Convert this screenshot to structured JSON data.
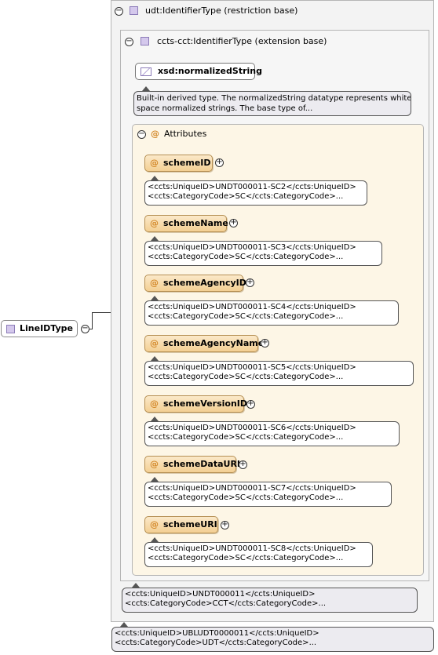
{
  "root": {
    "label": "LineIDType",
    "toggle": "−"
  },
  "udt": {
    "label": "udt:IdentifierType (restriction base)",
    "toggle": "−"
  },
  "ccts": {
    "label": "ccts-cct:IdentifierType (extension base)",
    "toggle": "−"
  },
  "xsd": {
    "label": "xsd:normalizedString",
    "doc_line1": "Built-in derived type. The normalizedString datatype represents white",
    "doc_line2": "space normalized strings. The base type of..."
  },
  "attributes": {
    "label": "Attributes",
    "toggle": "−",
    "items": [
      {
        "name": "schemeID",
        "expand": "+",
        "doc_line1": "<ccts:UniqueID>UNDT000011-SC2</ccts:UniqueID>",
        "doc_line2": "<ccts:CategoryCode>SC</ccts:CategoryCode>..."
      },
      {
        "name": "schemeName",
        "expand": "+",
        "doc_line1": "<ccts:UniqueID>UNDT000011-SC3</ccts:UniqueID>",
        "doc_line2": "<ccts:CategoryCode>SC</ccts:CategoryCode>..."
      },
      {
        "name": "schemeAgencyID",
        "expand": "+",
        "doc_line1": "<ccts:UniqueID>UNDT000011-SC4</ccts:UniqueID>",
        "doc_line2": "<ccts:CategoryCode>SC</ccts:CategoryCode>..."
      },
      {
        "name": "schemeAgencyName",
        "expand": "+",
        "doc_line1": "<ccts:UniqueID>UNDT000011-SC5</ccts:UniqueID>",
        "doc_line2": "<ccts:CategoryCode>SC</ccts:CategoryCode>..."
      },
      {
        "name": "schemeVersionID",
        "expand": "+",
        "doc_line1": "<ccts:UniqueID>UNDT000011-SC6</ccts:UniqueID>",
        "doc_line2": "<ccts:CategoryCode>SC</ccts:CategoryCode>..."
      },
      {
        "name": "schemeDataURI",
        "expand": "+",
        "doc_line1": "<ccts:UniqueID>UNDT000011-SC7</ccts:UniqueID>",
        "doc_line2": "<ccts:CategoryCode>SC</ccts:CategoryCode>..."
      },
      {
        "name": "schemeURI",
        "expand": "+",
        "doc_line1": "<ccts:UniqueID>UNDT000011-SC8</ccts:UniqueID>",
        "doc_line2": "<ccts:CategoryCode>SC</ccts:CategoryCode>..."
      }
    ]
  },
  "ccts_doc": {
    "line1": "<ccts:UniqueID>UNDT000011</ccts:UniqueID>",
    "line2": "<ccts:CategoryCode>CCT</ccts:CategoryCode>..."
  },
  "udt_doc": {
    "line1": "<ccts:UniqueID>UBLUDT0000011</ccts:UniqueID>",
    "line2": "<ccts:CategoryCode>UDT</ccts:CategoryCode>..."
  },
  "colors": {
    "type_icon": "#d4c8ec",
    "attribute_pill": "#f3cf93",
    "attribute_group_bg": "#fdf6e6",
    "outer_box_bg": "#f3f3f3",
    "annotation_bg": "#ecebf0"
  },
  "icons": {
    "type": "complex-type-icon",
    "simple": "simple-type-icon",
    "attribute": "attribute-at-icon",
    "collapse": "minus-circle-icon",
    "expand": "plus-circle-icon"
  }
}
